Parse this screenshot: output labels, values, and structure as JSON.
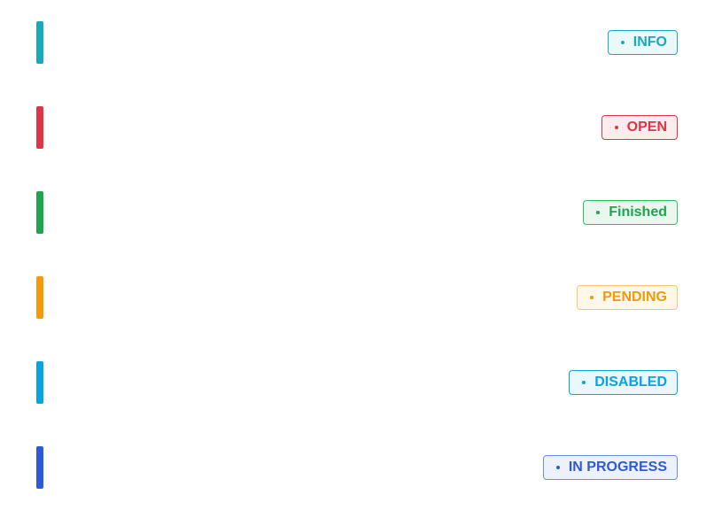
{
  "statuses": [
    {
      "label": "INFO",
      "color": "#1aa8bf",
      "bg": "#eaf8fa",
      "border": "#1aa8bf",
      "dot_icon": "bullet-dot-icon"
    },
    {
      "label": "OPEN",
      "color": "#dc3545",
      "bg": "#fcecee",
      "border": "#dc3545",
      "dot_icon": "bullet-dot-icon"
    },
    {
      "label": "Finished",
      "color": "#1fa550",
      "bg": "#eaf7ee",
      "border": "#28c15c",
      "dot_icon": "bullet-dot-icon"
    },
    {
      "label": "PENDING",
      "color": "#f29a0a",
      "bg": "#fff8e8",
      "border": "#f7c56b",
      "dot_icon": "bullet-dot-icon"
    },
    {
      "label": "DISABLED",
      "color": "#08a4e0",
      "bg": "#eaf7fd",
      "border": "#08a4e0",
      "dot_icon": "bullet-dot-icon"
    },
    {
      "label": "IN PROGRESS",
      "color": "#2d5bd8",
      "bg": "#ecf1fc",
      "border": "#6b8fe6",
      "dot_icon": "bullet-dot-icon"
    }
  ]
}
